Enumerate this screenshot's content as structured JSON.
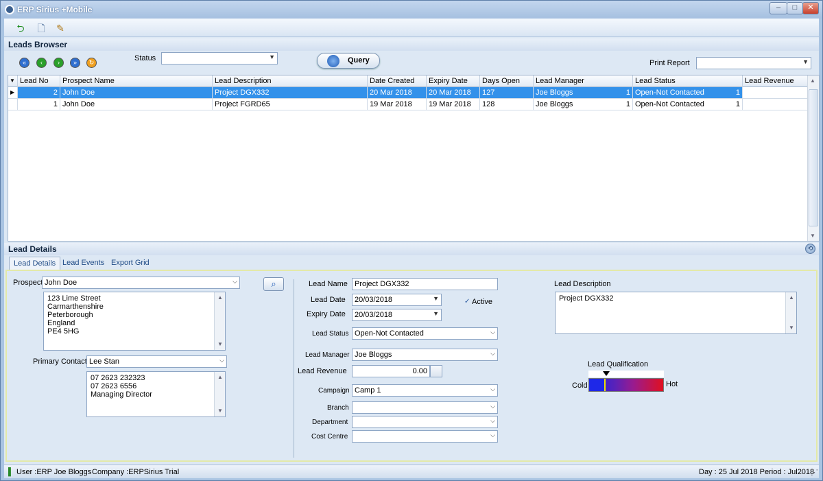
{
  "window": {
    "title": "ERP Sirius +Mobile",
    "min_label": "–",
    "max_label": "□",
    "close_label": "✕"
  },
  "toolbar": {
    "icons": [
      "back-arrow-icon",
      "new-document-icon",
      "edit-document-icon"
    ]
  },
  "leads_browser": {
    "header": "Leads Browser",
    "status_label": "Status",
    "status_value": "",
    "query_label": "Query",
    "print_report_label": "Print Report",
    "print_report_value": ""
  },
  "grid": {
    "columns": [
      "Lead No",
      "Prospect Name",
      "Lead Description",
      "Date Created",
      "Expiry Date",
      "Days Open",
      "Lead Manager",
      "Lead Status",
      "Lead Revenue"
    ],
    "rows": [
      {
        "lead_no": "2",
        "prospect": "John Doe",
        "description": "Project DGX332",
        "date_created": "20 Mar 2018",
        "expiry": "20 Mar 2018",
        "days_open": "127",
        "manager": "Joe Bloggs",
        "manager_id": "1",
        "status": "Open-Not Contacted",
        "status_id": "1",
        "revenue": ""
      },
      {
        "lead_no": "1",
        "prospect": "John Doe",
        "description": "Project FGRD65",
        "date_created": "19 Mar 2018",
        "expiry": "19 Mar 2018",
        "days_open": "128",
        "manager": "Joe Bloggs",
        "manager_id": "1",
        "status": "Open-Not Contacted",
        "status_id": "1",
        "revenue": ""
      }
    ]
  },
  "lead_details": {
    "header": "Lead Details",
    "tabs": [
      "Lead Details",
      "Lead Events",
      "Export Grid"
    ],
    "prospect_label": "Prospect",
    "prospect_value": "John Doe",
    "address_lines": [
      "123 Lime Street",
      "Carmarthenshire",
      "Peterborough",
      "England",
      "PE4 5HG"
    ],
    "primary_contact_label": "Primary Contact",
    "primary_contact_value": "Lee Stan",
    "contact_lines": [
      "07 2623 232323",
      "07 2623 6556",
      "Managing Director"
    ],
    "lead_name_label": "Lead Name",
    "lead_name_value": "Project DGX332",
    "lead_date_label": "Lead Date",
    "lead_date_value": "20/03/2018",
    "active_label": "Active",
    "expiry_date_label": "Expiry Date",
    "expiry_date_value": "20/03/2018",
    "lead_status_label": "Lead Status",
    "lead_status_value": "Open-Not Contacted",
    "lead_manager_label": "Lead Manager",
    "lead_manager_value": "Joe Bloggs",
    "lead_revenue_label": "Lead Revenue",
    "lead_revenue_value": "0.00",
    "campaign_label": "Campaign",
    "campaign_value": "Camp 1",
    "branch_label": "Branch",
    "branch_value": "",
    "department_label": "Department",
    "department_value": "",
    "cost_centre_label": "Cost Centre",
    "cost_centre_value": "",
    "lead_description_label": "Lead Description",
    "lead_description_value": "Project DGX332",
    "lead_qualification_label": "Lead Qualification",
    "cold_label": "Cold",
    "hot_label": "Hot"
  },
  "statusbar": {
    "user": "User :ERP Joe Bloggs",
    "company": "Company :ERPSirius Trial",
    "day_period": "Day : 25 Jul 2018  Period : Jul2018"
  }
}
